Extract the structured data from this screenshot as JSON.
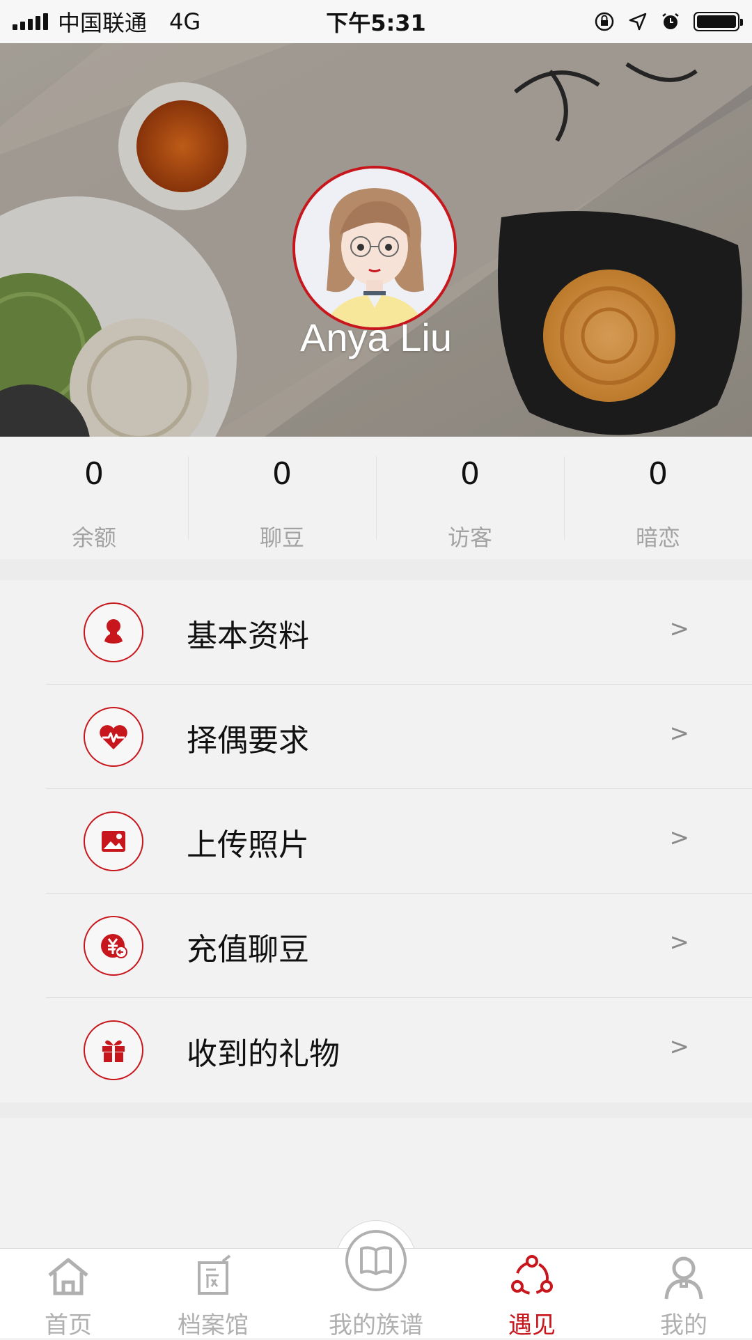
{
  "status_bar": {
    "carrier": "中国联通",
    "network": "4G",
    "time": "下午5:31"
  },
  "profile": {
    "name": "Anya Liu"
  },
  "stats": [
    {
      "value": "0",
      "label": "余额"
    },
    {
      "value": "0",
      "label": "聊豆"
    },
    {
      "value": "0",
      "label": "访客"
    },
    {
      "value": "0",
      "label": "暗恋"
    }
  ],
  "menu": [
    {
      "label": "基本资料",
      "arrow": ">",
      "icon": "person-icon"
    },
    {
      "label": "择偶要求",
      "arrow": ">",
      "icon": "heart-pulse-icon"
    },
    {
      "label": "上传照片",
      "arrow": ">",
      "icon": "photo-icon"
    },
    {
      "label": "充值聊豆",
      "arrow": ">",
      "icon": "yen-recharge-icon"
    },
    {
      "label": "收到的礼物",
      "arrow": ">",
      "icon": "gift-icon"
    }
  ],
  "tabs": [
    {
      "label": "首页",
      "icon": "home-icon"
    },
    {
      "label": "档案馆",
      "icon": "archive-icon"
    },
    {
      "label": "我的族谱",
      "icon": "book-icon"
    },
    {
      "label": "遇见",
      "icon": "meet-icon",
      "active": true
    },
    {
      "label": "我的",
      "icon": "user-icon"
    }
  ],
  "colors": {
    "accent": "#c8161d",
    "inactive": "#b0b0b0",
    "background": "#f2f2f2"
  }
}
